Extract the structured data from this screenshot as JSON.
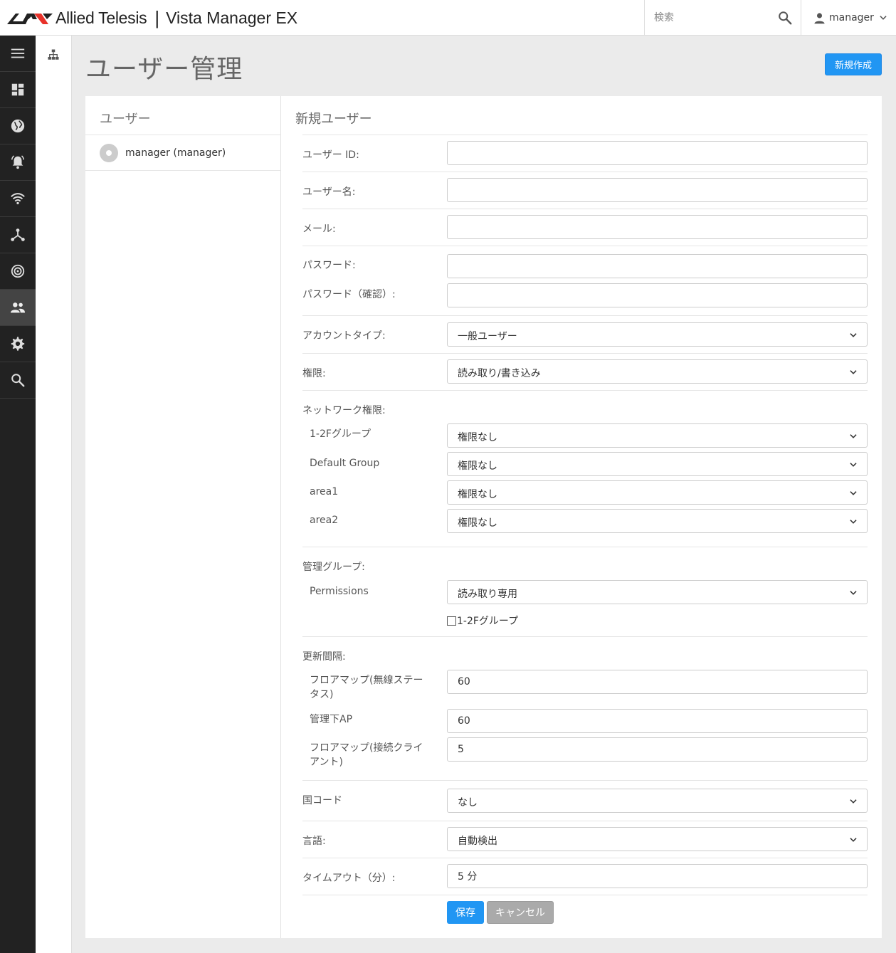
{
  "header": {
    "brand": "Allied Telesis",
    "brand_separator": "|",
    "product": "Vista Manager EX",
    "search_placeholder": "検索",
    "user": "manager"
  },
  "page": {
    "title": "ユーザー管理",
    "new_button": "新規作成"
  },
  "users_panel": {
    "title": "ユーザー",
    "users": [
      {
        "label": "manager (manager)"
      }
    ]
  },
  "form": {
    "title": "新規ユーザー",
    "user_id": {
      "label": "ユーザー ID:",
      "value": ""
    },
    "user_name": {
      "label": "ユーザー名:",
      "value": ""
    },
    "email": {
      "label": "メール:",
      "value": ""
    },
    "password": {
      "label": "パスワード:",
      "value": ""
    },
    "password_confirm": {
      "label": "パスワード（確認）:",
      "value": ""
    },
    "account_type": {
      "label": "アカウントタイプ:",
      "value": "一般ユーザー"
    },
    "permission": {
      "label": "権限:",
      "value": "読み取り/書き込み"
    },
    "network_permissions": {
      "label": "ネットワーク権限:",
      "rows": [
        {
          "label": "1-2Fグループ",
          "value": "権限なし"
        },
        {
          "label": "Default Group",
          "value": "権限なし"
        },
        {
          "label": "area1",
          "value": "権限なし"
        },
        {
          "label": "area2",
          "value": "権限なし"
        }
      ]
    },
    "admin_group": {
      "label": "管理グループ:",
      "permissions_label": "Permissions",
      "permissions_value": "読み取り専用",
      "checkbox_label": "1-2Fグループ",
      "checkbox_checked": false
    },
    "refresh": {
      "label": "更新間隔:",
      "floor_wireless": {
        "label": "フロアマップ(無線ステータス)",
        "value": "60"
      },
      "managed_ap": {
        "label": "管理下AP",
        "value": "60"
      },
      "floor_clients": {
        "label": "フロアマップ(接続クライアント)",
        "value": "5"
      }
    },
    "country": {
      "label": "国コード",
      "value": "なし"
    },
    "language": {
      "label": "言語:",
      "value": "自動検出"
    },
    "timeout": {
      "label": "タイムアウト（分）:",
      "value": "5 分"
    },
    "save_button": "保存",
    "cancel_button": "キャンセル"
  },
  "icons": {
    "nav": [
      "menu-icon",
      "dashboard-icon",
      "globe-icon",
      "alarm-icon",
      "wifi-icon",
      "network-icon",
      "radar-icon",
      "users-icon",
      "gear-icon",
      "search-icon"
    ],
    "subnav": "tree-icon"
  },
  "colors": {
    "accent": "#2196f3",
    "nav_bg": "#222222",
    "nav_active": "#444444"
  }
}
